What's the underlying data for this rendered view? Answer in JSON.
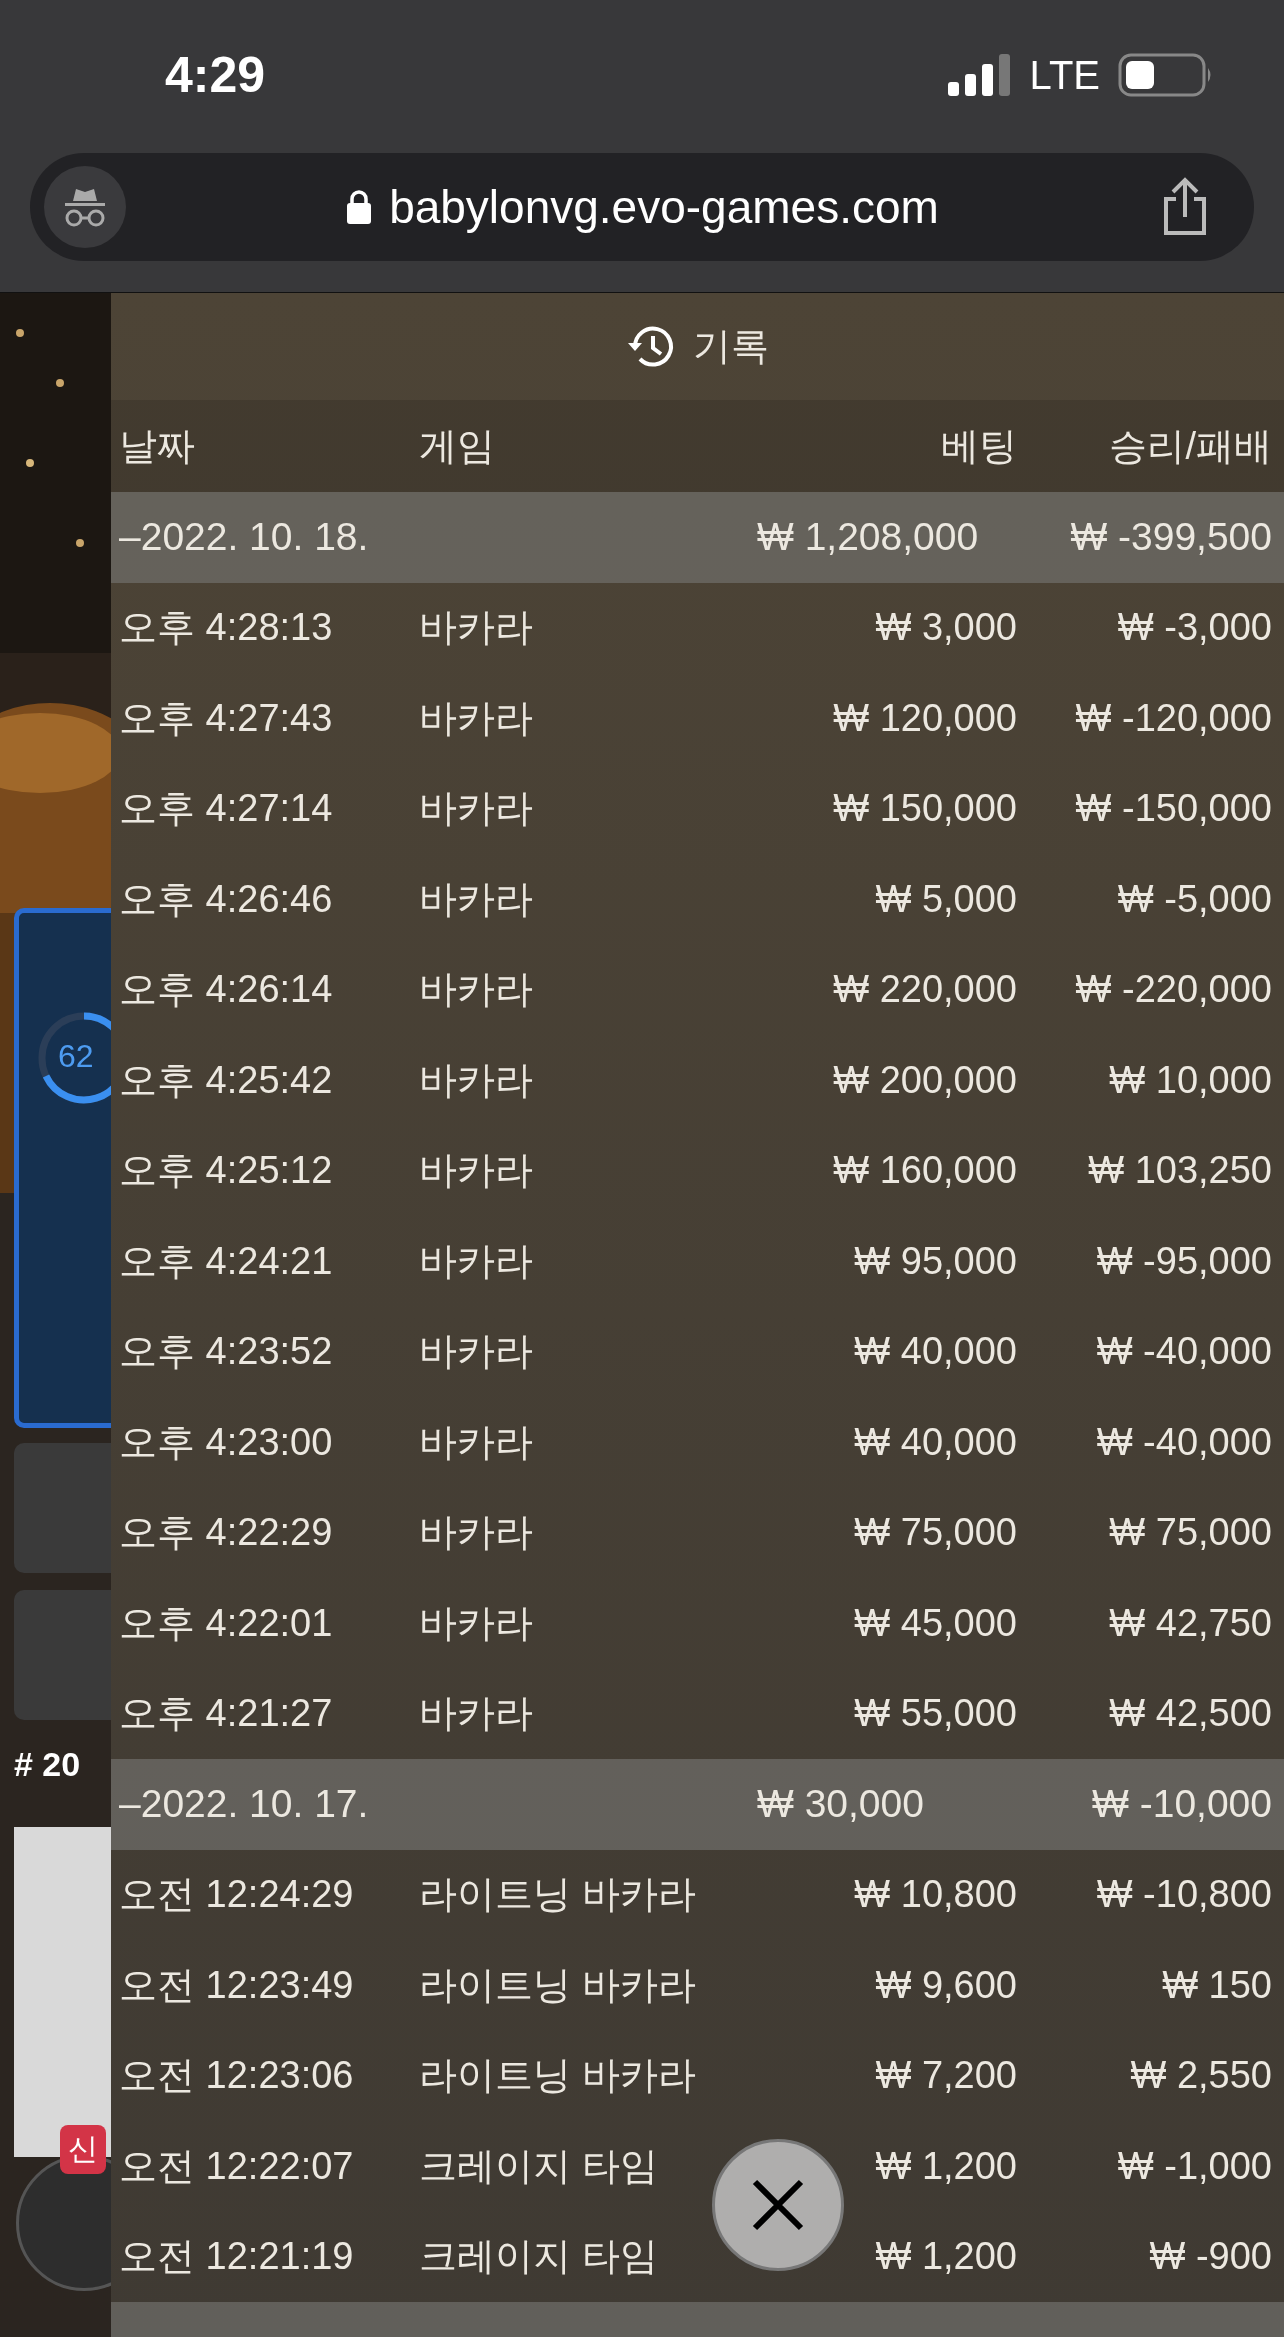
{
  "status_bar": {
    "time": "4:29",
    "network": "LTE"
  },
  "address_bar": {
    "url": "babylonvg.evo-games.com"
  },
  "background": {
    "meter_text": "62",
    "round_label": "# 20",
    "badge": "신"
  },
  "history": {
    "title": "기록",
    "columns": [
      "날짜",
      "게임",
      "베팅",
      "승리/패배"
    ],
    "groups": [
      {
        "date": "–2022. 10. 18.",
        "bet": "₩ 1,208,000",
        "result": "₩ -399,500",
        "rows": [
          {
            "time": "오후 4:28:13",
            "game": "바카라",
            "bet": "₩ 3,000",
            "result": "₩ -3,000"
          },
          {
            "time": "오후 4:27:43",
            "game": "바카라",
            "bet": "₩ 120,000",
            "result": "₩ -120,000"
          },
          {
            "time": "오후 4:27:14",
            "game": "바카라",
            "bet": "₩ 150,000",
            "result": "₩ -150,000"
          },
          {
            "time": "오후 4:26:46",
            "game": "바카라",
            "bet": "₩ 5,000",
            "result": "₩ -5,000"
          },
          {
            "time": "오후 4:26:14",
            "game": "바카라",
            "bet": "₩ 220,000",
            "result": "₩ -220,000"
          },
          {
            "time": "오후 4:25:42",
            "game": "바카라",
            "bet": "₩ 200,000",
            "result": "₩ 10,000"
          },
          {
            "time": "오후 4:25:12",
            "game": "바카라",
            "bet": "₩ 160,000",
            "result": "₩ 103,250"
          },
          {
            "time": "오후 4:24:21",
            "game": "바카라",
            "bet": "₩ 95,000",
            "result": "₩ -95,000"
          },
          {
            "time": "오후 4:23:52",
            "game": "바카라",
            "bet": "₩ 40,000",
            "result": "₩ -40,000"
          },
          {
            "time": "오후 4:23:00",
            "game": "바카라",
            "bet": "₩ 40,000",
            "result": "₩ -40,000"
          },
          {
            "time": "오후 4:22:29",
            "game": "바카라",
            "bet": "₩ 75,000",
            "result": "₩ 75,000"
          },
          {
            "time": "오후 4:22:01",
            "game": "바카라",
            "bet": "₩ 45,000",
            "result": "₩ 42,750"
          },
          {
            "time": "오후 4:21:27",
            "game": "바카라",
            "bet": "₩ 55,000",
            "result": "₩ 42,500"
          }
        ]
      },
      {
        "date": "–2022. 10. 17.",
        "bet": "₩ 30,000",
        "result": "₩ -10,000",
        "rows": [
          {
            "time": "오전 12:24:29",
            "game": "라이트닝 바카라",
            "bet": "₩ 10,800",
            "result": "₩ -10,800"
          },
          {
            "time": "오전 12:23:49",
            "game": "라이트닝 바카라",
            "bet": "₩ 9,600",
            "result": "₩ 150"
          },
          {
            "time": "오전 12:23:06",
            "game": "라이트닝 바카라",
            "bet": "₩ 7,200",
            "result": "₩ 2,550"
          },
          {
            "time": "오전 12:22:07",
            "game": "크레이지 타임",
            "bet": "₩ 1,200",
            "result": "₩ -1,000"
          },
          {
            "time": "오전 12:21:19",
            "game": "크레이지 타임",
            "bet": "₩ 1,200",
            "result": "₩ -900"
          }
        ]
      }
    ]
  }
}
